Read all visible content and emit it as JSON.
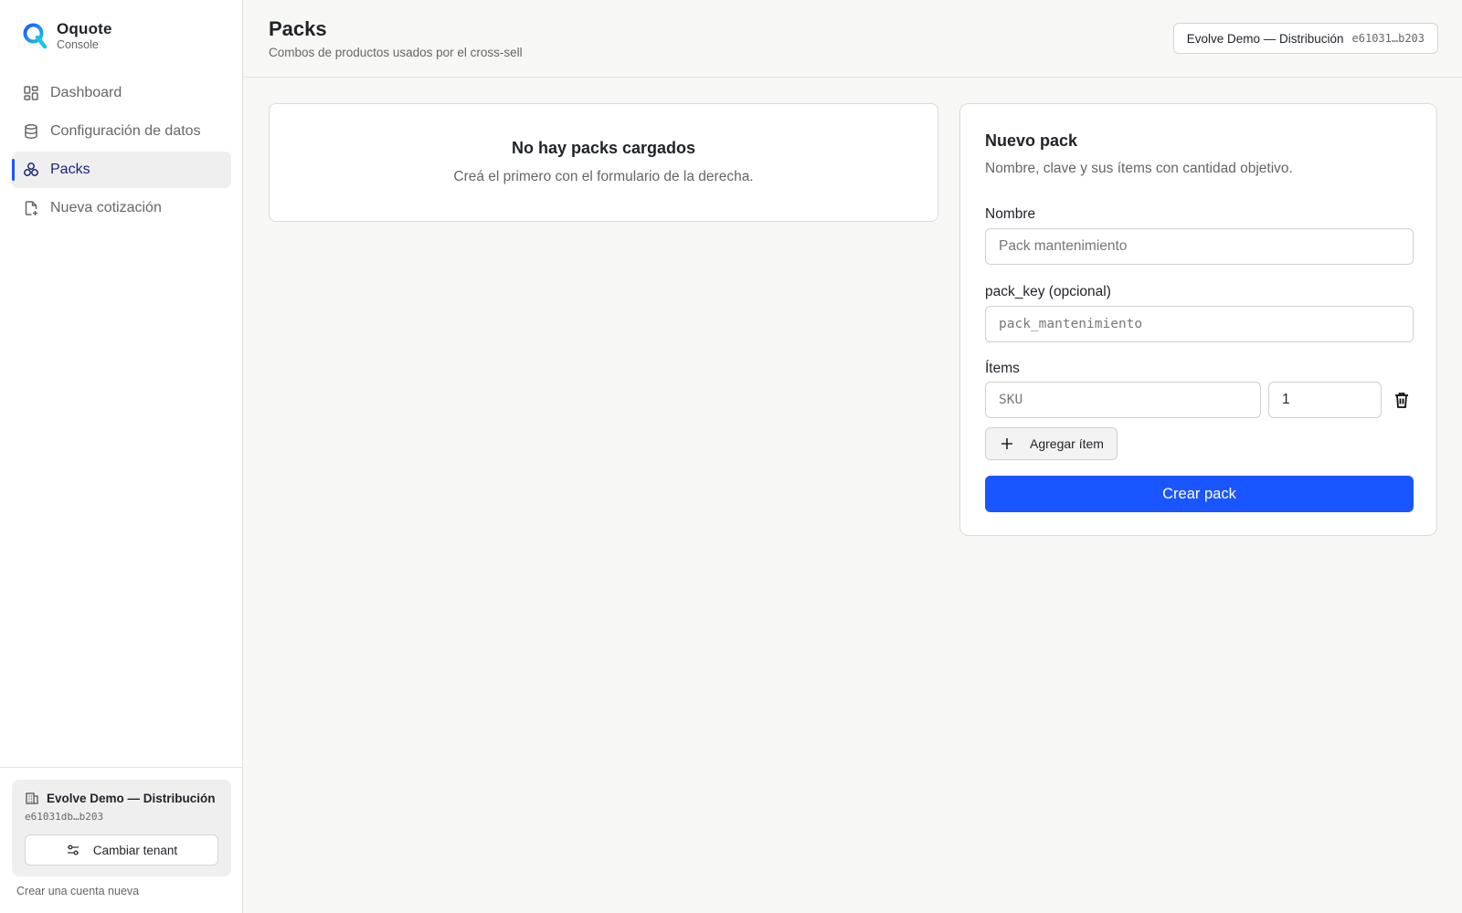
{
  "brand": {
    "name": "Oquote",
    "subtitle": "Console"
  },
  "nav": {
    "items": [
      {
        "label": "Dashboard",
        "icon": "dashboard-icon"
      },
      {
        "label": "Configuración de datos",
        "icon": "database-icon"
      },
      {
        "label": "Packs",
        "icon": "packs-icon",
        "active": true
      },
      {
        "label": "Nueva cotización",
        "icon": "file-plus-icon"
      }
    ]
  },
  "sidebar_footer": {
    "tenant_name": "Evolve Demo — Distribución",
    "tenant_id": "e61031db…b203",
    "switch_label": "Cambiar tenant",
    "create_account": "Crear una cuenta nueva"
  },
  "header": {
    "title": "Packs",
    "subtitle": "Combos de productos usados por el cross-sell",
    "tenant_chip_name": "Evolve Demo — Distribución",
    "tenant_chip_id": "e61031…b203"
  },
  "empty_state": {
    "title": "No hay packs cargados",
    "subtitle": "Creá el primero con el formulario de la derecha."
  },
  "form": {
    "title": "Nuevo pack",
    "description": "Nombre, clave y sus ítems con cantidad objetivo.",
    "name_label": "Nombre",
    "name_placeholder": "Pack mantenimiento",
    "key_label": "pack_key (opcional)",
    "key_placeholder": "pack_mantenimiento",
    "items_label": "Ítems",
    "sku_placeholder": "SKU",
    "qty_value": "1",
    "add_item_label": "Agregar ítem",
    "submit_label": "Crear pack"
  },
  "colors": {
    "accent": "#1a56ff",
    "nav_active_text": "#1a237e"
  }
}
